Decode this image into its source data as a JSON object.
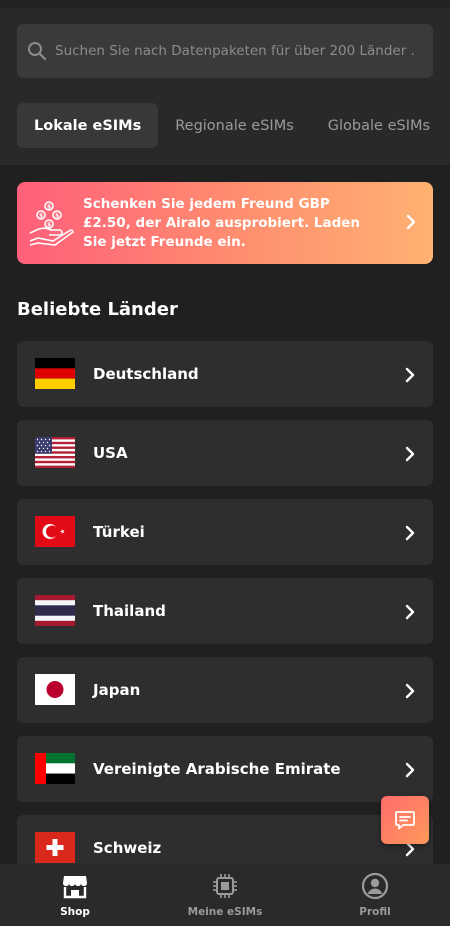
{
  "search": {
    "placeholder": "Suchen Sie nach Datenpaketen für über 200 Länder ..."
  },
  "tabs": [
    {
      "label": "Lokale eSIMs",
      "active": true
    },
    {
      "label": "Regionale eSIMs",
      "active": false
    },
    {
      "label": "Globale eSIMs",
      "active": false
    }
  ],
  "promo": {
    "text": "Schenken Sie jedem Freund GBP £2.50, der Airalo ausprobiert. Laden Sie jetzt Freunde ein."
  },
  "section": {
    "title": "Beliebte Länder"
  },
  "countries": [
    {
      "label": "Deutschland",
      "flag": "germany-flag-icon"
    },
    {
      "label": "USA",
      "flag": "usa-flag-icon"
    },
    {
      "label": "Türkei",
      "flag": "turkey-flag-icon"
    },
    {
      "label": "Thailand",
      "flag": "thailand-flag-icon"
    },
    {
      "label": "Japan",
      "flag": "japan-flag-icon"
    },
    {
      "label": "Vereinigte Arabische Emirate",
      "flag": "uae-flag-icon"
    },
    {
      "label": "Schweiz",
      "flag": "switzerland-flag-icon"
    }
  ],
  "nav": [
    {
      "label": "Shop",
      "icon": "shop-icon",
      "active": true
    },
    {
      "label": "Meine eSIMs",
      "icon": "sim-chip-icon",
      "active": false
    },
    {
      "label": "Profil",
      "icon": "profile-icon",
      "active": false
    }
  ],
  "colors": {
    "background": "#202020",
    "card": "#2e2e2e",
    "promo_start": "#ff5f7a",
    "promo_end": "#ffb272"
  }
}
